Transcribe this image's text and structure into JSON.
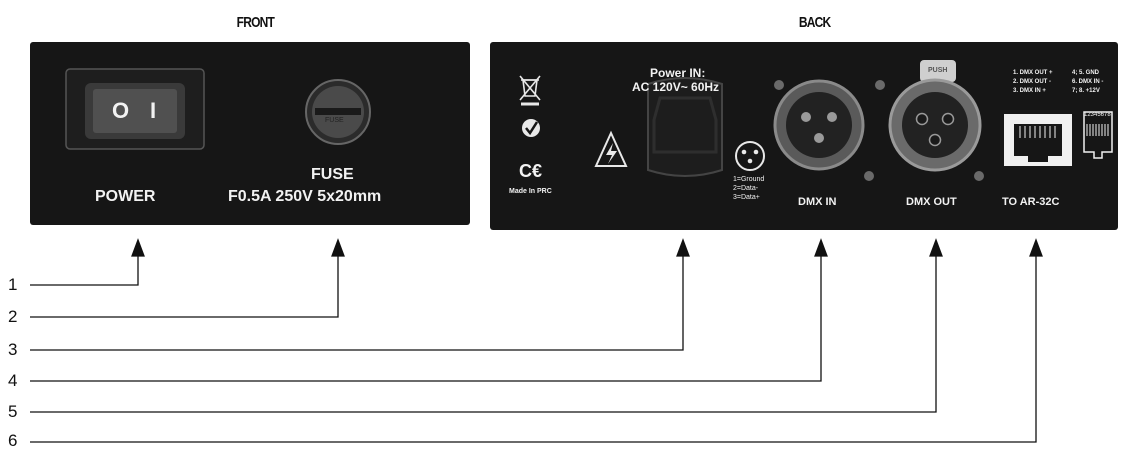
{
  "front": {
    "title": "FRONT",
    "power_label": "POWER",
    "switch_off": "O",
    "switch_on": "I",
    "fuse_cap_text": "FUSE",
    "fuse_label": "FUSE",
    "fuse_spec": "F0.5A 250V 5x20mm"
  },
  "back": {
    "title": "BACK",
    "power_in_line1": "Power IN:",
    "power_in_line2": "AC 120V~ 60Hz",
    "made_in": "Made In PRC",
    "pinout": [
      "1=Ground",
      "2=Data-",
      "3=Data+"
    ],
    "dmx_in": "DMX IN",
    "dmx_out": "DMX OUT",
    "to_ar": "TO AR-32C",
    "rj45_legend_left": [
      "1. DMX OUT +",
      "2. DMX OUT -",
      "3. DMX IN +"
    ],
    "rj45_legend_right": [
      "4; 5. GND",
      "6. DMX IN -",
      "7; 8. +12V"
    ],
    "rj45_numbers": "12345678",
    "latch_text": "PUSH"
  },
  "callouts": [
    "1",
    "2",
    "3",
    "4",
    "5",
    "6"
  ]
}
